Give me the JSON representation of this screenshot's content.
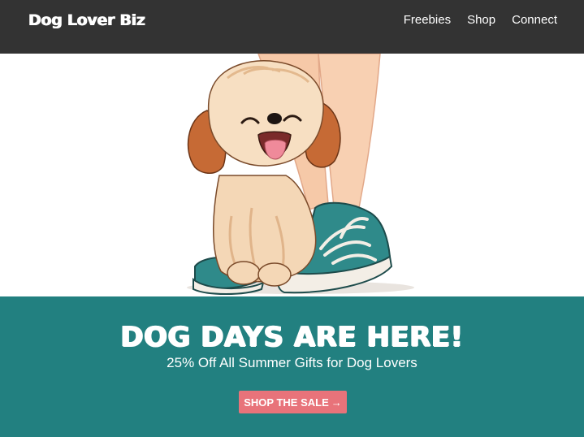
{
  "header": {
    "brand": "Dog Lover Biz",
    "nav": [
      {
        "label": "Freebies"
      },
      {
        "label": "Shop"
      },
      {
        "label": "Connect"
      }
    ]
  },
  "hero": {
    "illustration": "cartoon-puppy-with-sneakers"
  },
  "banner": {
    "headline": "DOG DAYS ARE HERE!",
    "subhead": "25% Off All Summer Gifts for Dog Lovers",
    "cta_label": "SHOP THE SALE",
    "cta_icon": "arrow-right-icon"
  },
  "colors": {
    "header_bg": "#333333",
    "banner_bg": "#228080",
    "cta_bg": "#e8737a"
  }
}
